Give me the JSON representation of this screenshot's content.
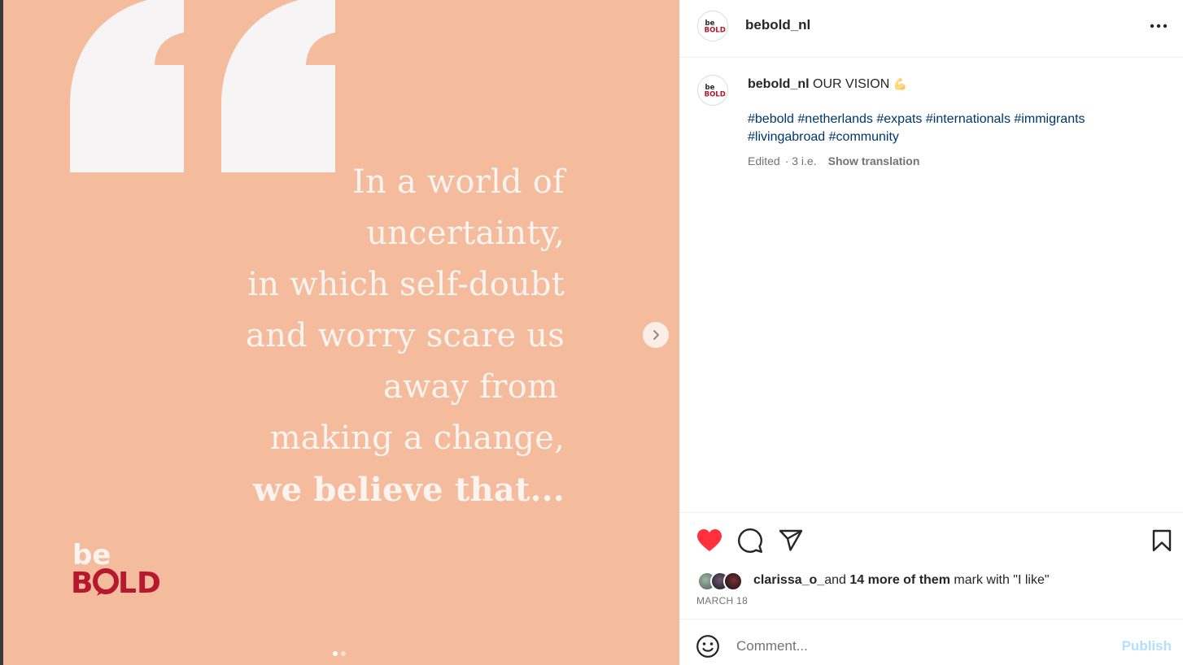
{
  "post": {
    "username": "bebold_nl",
    "caption_title": "OUR VISION",
    "caption_emoji": "💪",
    "hashtags": [
      "#bebold",
      "#netherlands",
      "#expats",
      "#internationals",
      "#immigrants",
      "#livingabroad",
      "#community"
    ],
    "edited_label": "Edited",
    "time_ago": "· 3 i.e.",
    "show_translation": "Show translation",
    "date": "MARCH 18"
  },
  "media": {
    "quote_lines": [
      "In a world of",
      "uncertainty,",
      "in which self-doubt",
      "and worry scare us",
      "away from",
      "making a change,"
    ],
    "quote_bold_line": "we believe that...",
    "logo_top": "be",
    "logo_bottom": "BOLD",
    "slide_current": 1,
    "slide_total": 2
  },
  "likes": {
    "first_user": "clarissa_o_",
    "and_word": "and",
    "more_count_text": "14 more of them",
    "suffix": "mark with \"I like\""
  },
  "comment": {
    "placeholder": "Comment...",
    "publish_label": "Publish"
  },
  "colors": {
    "media_bg": "#f4bb9c",
    "quote_text": "#fbf3ef",
    "brand_red": "#b5182f",
    "like_red": "#ff3040",
    "hashtag_blue": "#00376b",
    "publish_disabled": "#b2dffc"
  },
  "icons": {
    "like": "heart-filled-icon",
    "comment": "speech-bubble-icon",
    "share": "paper-plane-icon",
    "save": "bookmark-icon",
    "more": "ellipsis-icon",
    "next": "chevron-right-icon",
    "emoji": "smiley-icon"
  }
}
